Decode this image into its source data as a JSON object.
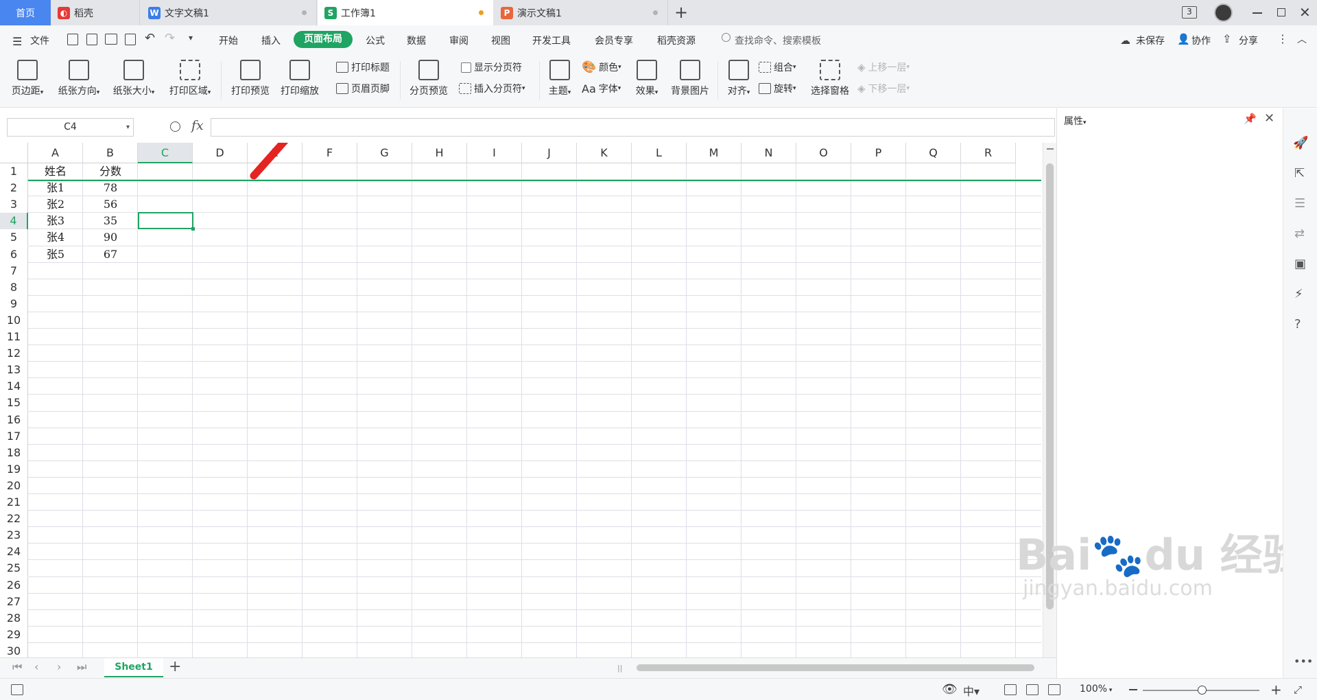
{
  "tabs": {
    "home": "首页",
    "daoke": "稻壳",
    "writer": "文字文稿1",
    "sheet": "工作簿1",
    "ppt": "演示文稿1",
    "new_tab": "+",
    "window_count": "3"
  },
  "menu": {
    "file": "文件",
    "items": [
      "开始",
      "插入",
      "页面布局",
      "公式",
      "数据",
      "审阅",
      "视图",
      "开发工具",
      "会员专享",
      "稻壳资源"
    ],
    "search_placeholder": "查找命令、搜索模板",
    "unsaved": "未保存",
    "collab": "协作",
    "share": "分享"
  },
  "ribbon": {
    "margins": "页边距",
    "orientation": "纸张方向",
    "size": "纸张大小",
    "print_area": "打印区域",
    "print_preview": "打印预览",
    "print_scale": "打印缩放",
    "print_titles": "打印标题",
    "header_footer": "页眉页脚",
    "page_break_preview": "分页预览",
    "show_page_breaks": "显示分页符",
    "insert_page_break": "插入分页符",
    "theme": "主题",
    "colors": "颜色",
    "fonts": "字体",
    "fonts_prefix": "Aa",
    "effects": "效果",
    "background": "背景图片",
    "align": "对齐",
    "group": "组合",
    "rotate": "旋转",
    "selection_pane": "选择窗格",
    "bring_forward": "上移一层",
    "send_backward": "下移一层"
  },
  "formula_bar": {
    "name_box": "C4",
    "fx": "fx",
    "content": ""
  },
  "grid": {
    "columns": [
      "A",
      "B",
      "C",
      "D",
      "E",
      "F",
      "G",
      "H",
      "I",
      "J",
      "K",
      "L",
      "M",
      "N",
      "O",
      "P",
      "Q",
      "R"
    ],
    "rows": [
      "1",
      "2",
      "3",
      "4",
      "5",
      "6",
      "7",
      "8",
      "9",
      "10",
      "11",
      "12",
      "13",
      "14",
      "15",
      "16",
      "17",
      "18",
      "19",
      "20",
      "21",
      "22",
      "23",
      "24",
      "25",
      "26",
      "27",
      "28",
      "29",
      "30"
    ],
    "data": [
      [
        "姓名",
        "分数"
      ],
      [
        "张1",
        "78"
      ],
      [
        "张2",
        "56"
      ],
      [
        "张3",
        "35"
      ],
      [
        "张4",
        "90"
      ],
      [
        "张5",
        "67"
      ]
    ],
    "active_cell": "C4"
  },
  "panel": {
    "title": "属性"
  },
  "sheet_tabs": {
    "active": "Sheet1",
    "add": "+"
  },
  "status": {
    "zoom": "100%"
  },
  "colors": {
    "accent": "#1fa463",
    "active_tab_underline": "#1fa463",
    "annotation_arrow": "#e52320"
  }
}
